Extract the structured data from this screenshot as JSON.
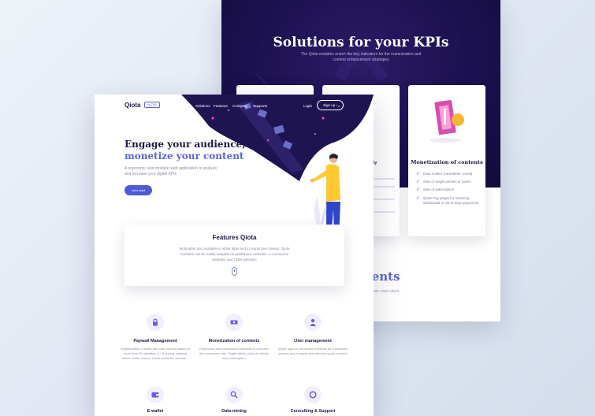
{
  "back_page": {
    "title": "Solutions for your KPIs",
    "subtitle": "The Qiota modules enrich the key indicators for the numerization and content enhancement strategies",
    "card_center_fragment": "lity",
    "card_right": {
      "title": "Monetization of contents",
      "bullets": [
        "Data Collect (newsletter, email)",
        "Sale of single articles or packs",
        "Sale of subscription",
        "Qiota Pay plugin for recurring withdrawal or via E-Sepa payments"
      ]
    },
    "section_word": "ients",
    "section_sub": "use case client"
  },
  "front_page": {
    "nav": {
      "logo": "Qiota",
      "badge": "by TBS",
      "links": [
        "Solutions",
        "Features",
        "Company",
        "Supports"
      ],
      "login": "Login",
      "signup": "Sign up"
    },
    "hero": {
      "title_line1": "Engage your audience,",
      "title_line2": "monetize your content",
      "text": "A ergonomic and modular web application to analyze and increase your digital KPIs",
      "cta": "Let's start"
    },
    "features_card": {
      "title": "Features Qiota",
      "text": "Modulable and available in white label and in responsive design. Qiota modules can be easily adapted on publishers' websites, e-commerce websites and CRM websites"
    },
    "features": [
      {
        "icon": "lock-icon",
        "title": "Paywall Management",
        "text": "Segmentation of traffic with user journey based on more than 50 variables. A / B testing, adblock detect, traffic source, social networks, devices..."
      },
      {
        "icon": "money-icon",
        "title": "Monetization of contents",
        "text": "Ergonomic and customized interfaces to increase the conversion rate. Single article, pack of articles and subscription"
      },
      {
        "icon": "user-icon",
        "title": "User management",
        "text": "Single sign-on connection interface for a customer journey and a simple and effective social connect"
      },
      {
        "icon": "wallet-icon",
        "title": "E-wallet",
        "text": ""
      },
      {
        "icon": "search-icon",
        "title": "Data-mining",
        "text": ""
      },
      {
        "icon": "support-icon",
        "title": "Consulting & Support",
        "text": ""
      }
    ]
  },
  "colors": {
    "accent": "#5a63e0",
    "dark": "#1b1746",
    "hero_bg": "#1c1150"
  }
}
